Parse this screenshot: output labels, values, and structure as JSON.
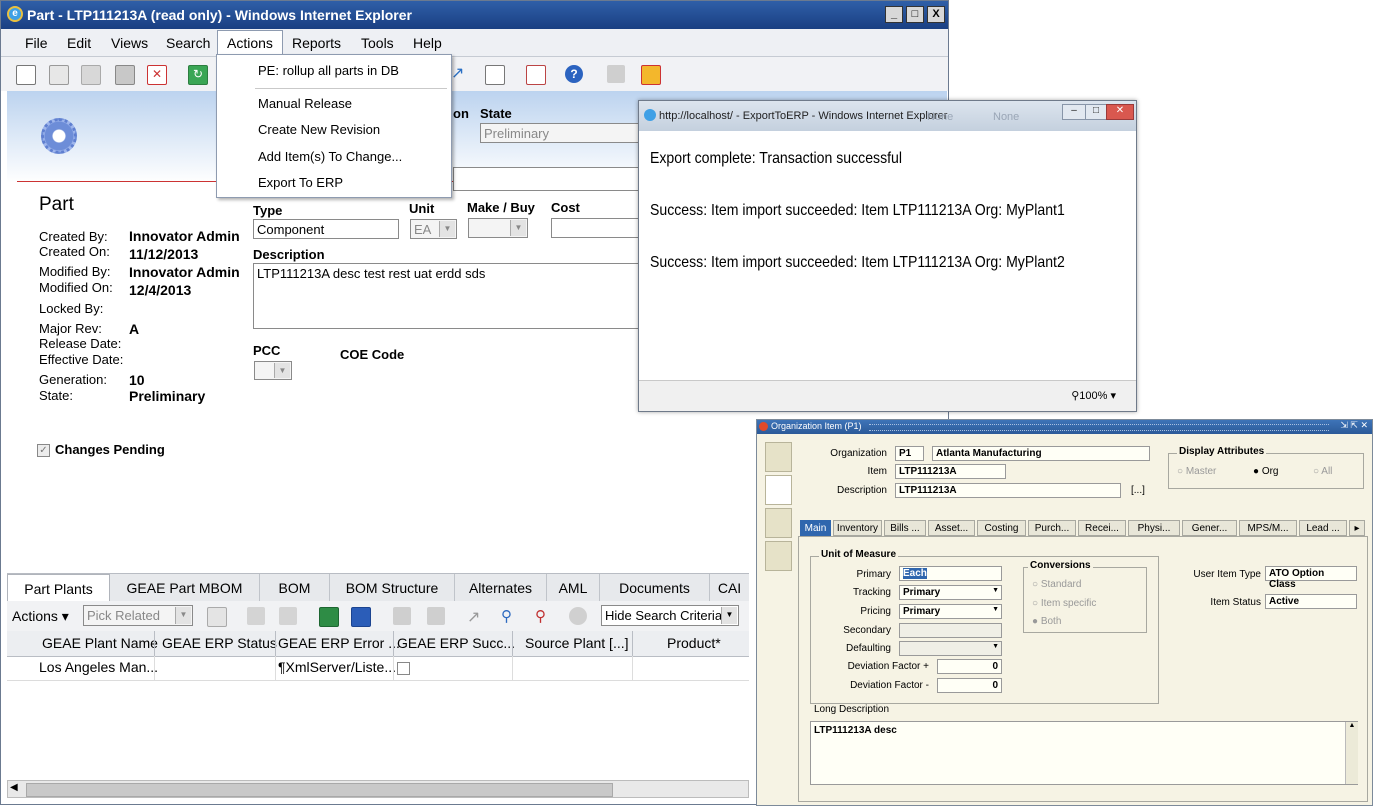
{
  "main_window": {
    "title": "Part - LTP111213A (read only) - Windows Internet Explorer",
    "window_buttons": [
      "_",
      "□",
      "X"
    ],
    "menu": [
      "File",
      "Edit",
      "Views",
      "Search",
      "Actions",
      "Reports",
      "Tools",
      "Help"
    ],
    "actions_menu": [
      "PE: rollup all parts in DB",
      "Manual Release",
      "Create New Revision",
      "Add Item(s) To Change...",
      "Export To ERP"
    ],
    "form": {
      "heading": "Part",
      "state_label": "State",
      "state_value": "Preliminary",
      "partial_label": "on",
      "meta": [
        {
          "label": "Created By:",
          "value": "Innovator Admin"
        },
        {
          "label": "Created On:",
          "value": "11/12/2013"
        },
        {
          "label": "Modified By:",
          "value": "Innovator Admin"
        },
        {
          "label": "Modified On:",
          "value": "12/4/2013"
        },
        {
          "label": "Locked By:",
          "value": ""
        },
        {
          "label": "Major Rev:",
          "value": "A"
        },
        {
          "label": "Release Date:",
          "value": ""
        },
        {
          "label": "Effective Date:",
          "value": ""
        },
        {
          "label": "Generation:",
          "value": "10"
        },
        {
          "label": "State:",
          "value": "Preliminary"
        }
      ],
      "type_label": "Type",
      "type_value": "Component",
      "unit_label": "Unit",
      "unit_value": "EA",
      "make_buy_label": "Make / Buy",
      "cost_label": "Cost",
      "description_label": "Description",
      "description_value": "LTP111213A desc test rest uat erdd sds",
      "pcc_label": "PCC",
      "coe_label": "COE Code",
      "changes_pending": "Changes Pending"
    },
    "tabs": [
      "Part Plants",
      "GEAE Part MBOM",
      "BOM",
      "BOM Structure",
      "Alternates",
      "AML",
      "Documents",
      "CAI"
    ],
    "grid_toolbar": {
      "actions": "Actions",
      "pick_related": "Pick Related",
      "hide_search": "Hide Search Criteria"
    },
    "grid_columns": [
      "GEAE Plant Name",
      "GEAE ERP Status",
      "GEAE ERP Error ...",
      "GEAE ERP Succ...",
      "Source Plant [...]",
      "Product*"
    ],
    "grid_rows": [
      {
        "plant": "Los Angeles Man...",
        "status": "",
        "error": "¶XmlServer/Liste..."
      }
    ]
  },
  "export_window": {
    "title": "http://localhost/ - ExportToERP - Windows Internet Explorer",
    "ghost_text": [
      "None",
      "None"
    ],
    "messages": [
      "Export complete: Transaction successful",
      "Success: Item import succeeded: Item LTP111213A Org: MyPlant1",
      "Success: Item import succeeded: Item LTP111213A Org: MyPlant2"
    ],
    "zoom": "100%"
  },
  "oracle_window": {
    "title": "Organization Item (P1)",
    "organization_label": "Organization",
    "organization_code": "P1",
    "organization_name": "Atlanta Manufacturing",
    "item_label": "Item",
    "item_value": "LTP111213A",
    "description_label": "Description",
    "description_value": "LTP111213A",
    "ellipsis": "[...]",
    "display_attributes": {
      "title": "Display Attributes",
      "options": [
        "Master",
        "Org",
        "All"
      ],
      "selected": "Org"
    },
    "tabs": [
      "Main",
      "Inventory",
      "Bills ...",
      "Asset...",
      "Costing",
      "Purch...",
      "Recei...",
      "Physi...",
      "Gener...",
      "MPS/M...",
      "Lead ..."
    ],
    "uom": {
      "title": "Unit of Measure",
      "fields": [
        {
          "label": "Primary",
          "value": "Each"
        },
        {
          "label": "Tracking",
          "value": "Primary"
        },
        {
          "label": "Pricing",
          "value": "Primary"
        },
        {
          "label": "Secondary",
          "value": ""
        },
        {
          "label": "Defaulting",
          "value": ""
        },
        {
          "label": "Deviation Factor +",
          "value": "0"
        },
        {
          "label": "Deviation Factor -",
          "value": "0"
        }
      ]
    },
    "conversions": {
      "title": "Conversions",
      "options": [
        "Standard",
        "Item specific",
        "Both"
      ]
    },
    "user_item_type_label": "User Item Type",
    "user_item_type_value": "ATO Option Class",
    "item_status_label": "Item Status",
    "item_status_value": "Active",
    "long_desc_label": "Long Description",
    "long_desc_value": "LTP111213A desc"
  }
}
